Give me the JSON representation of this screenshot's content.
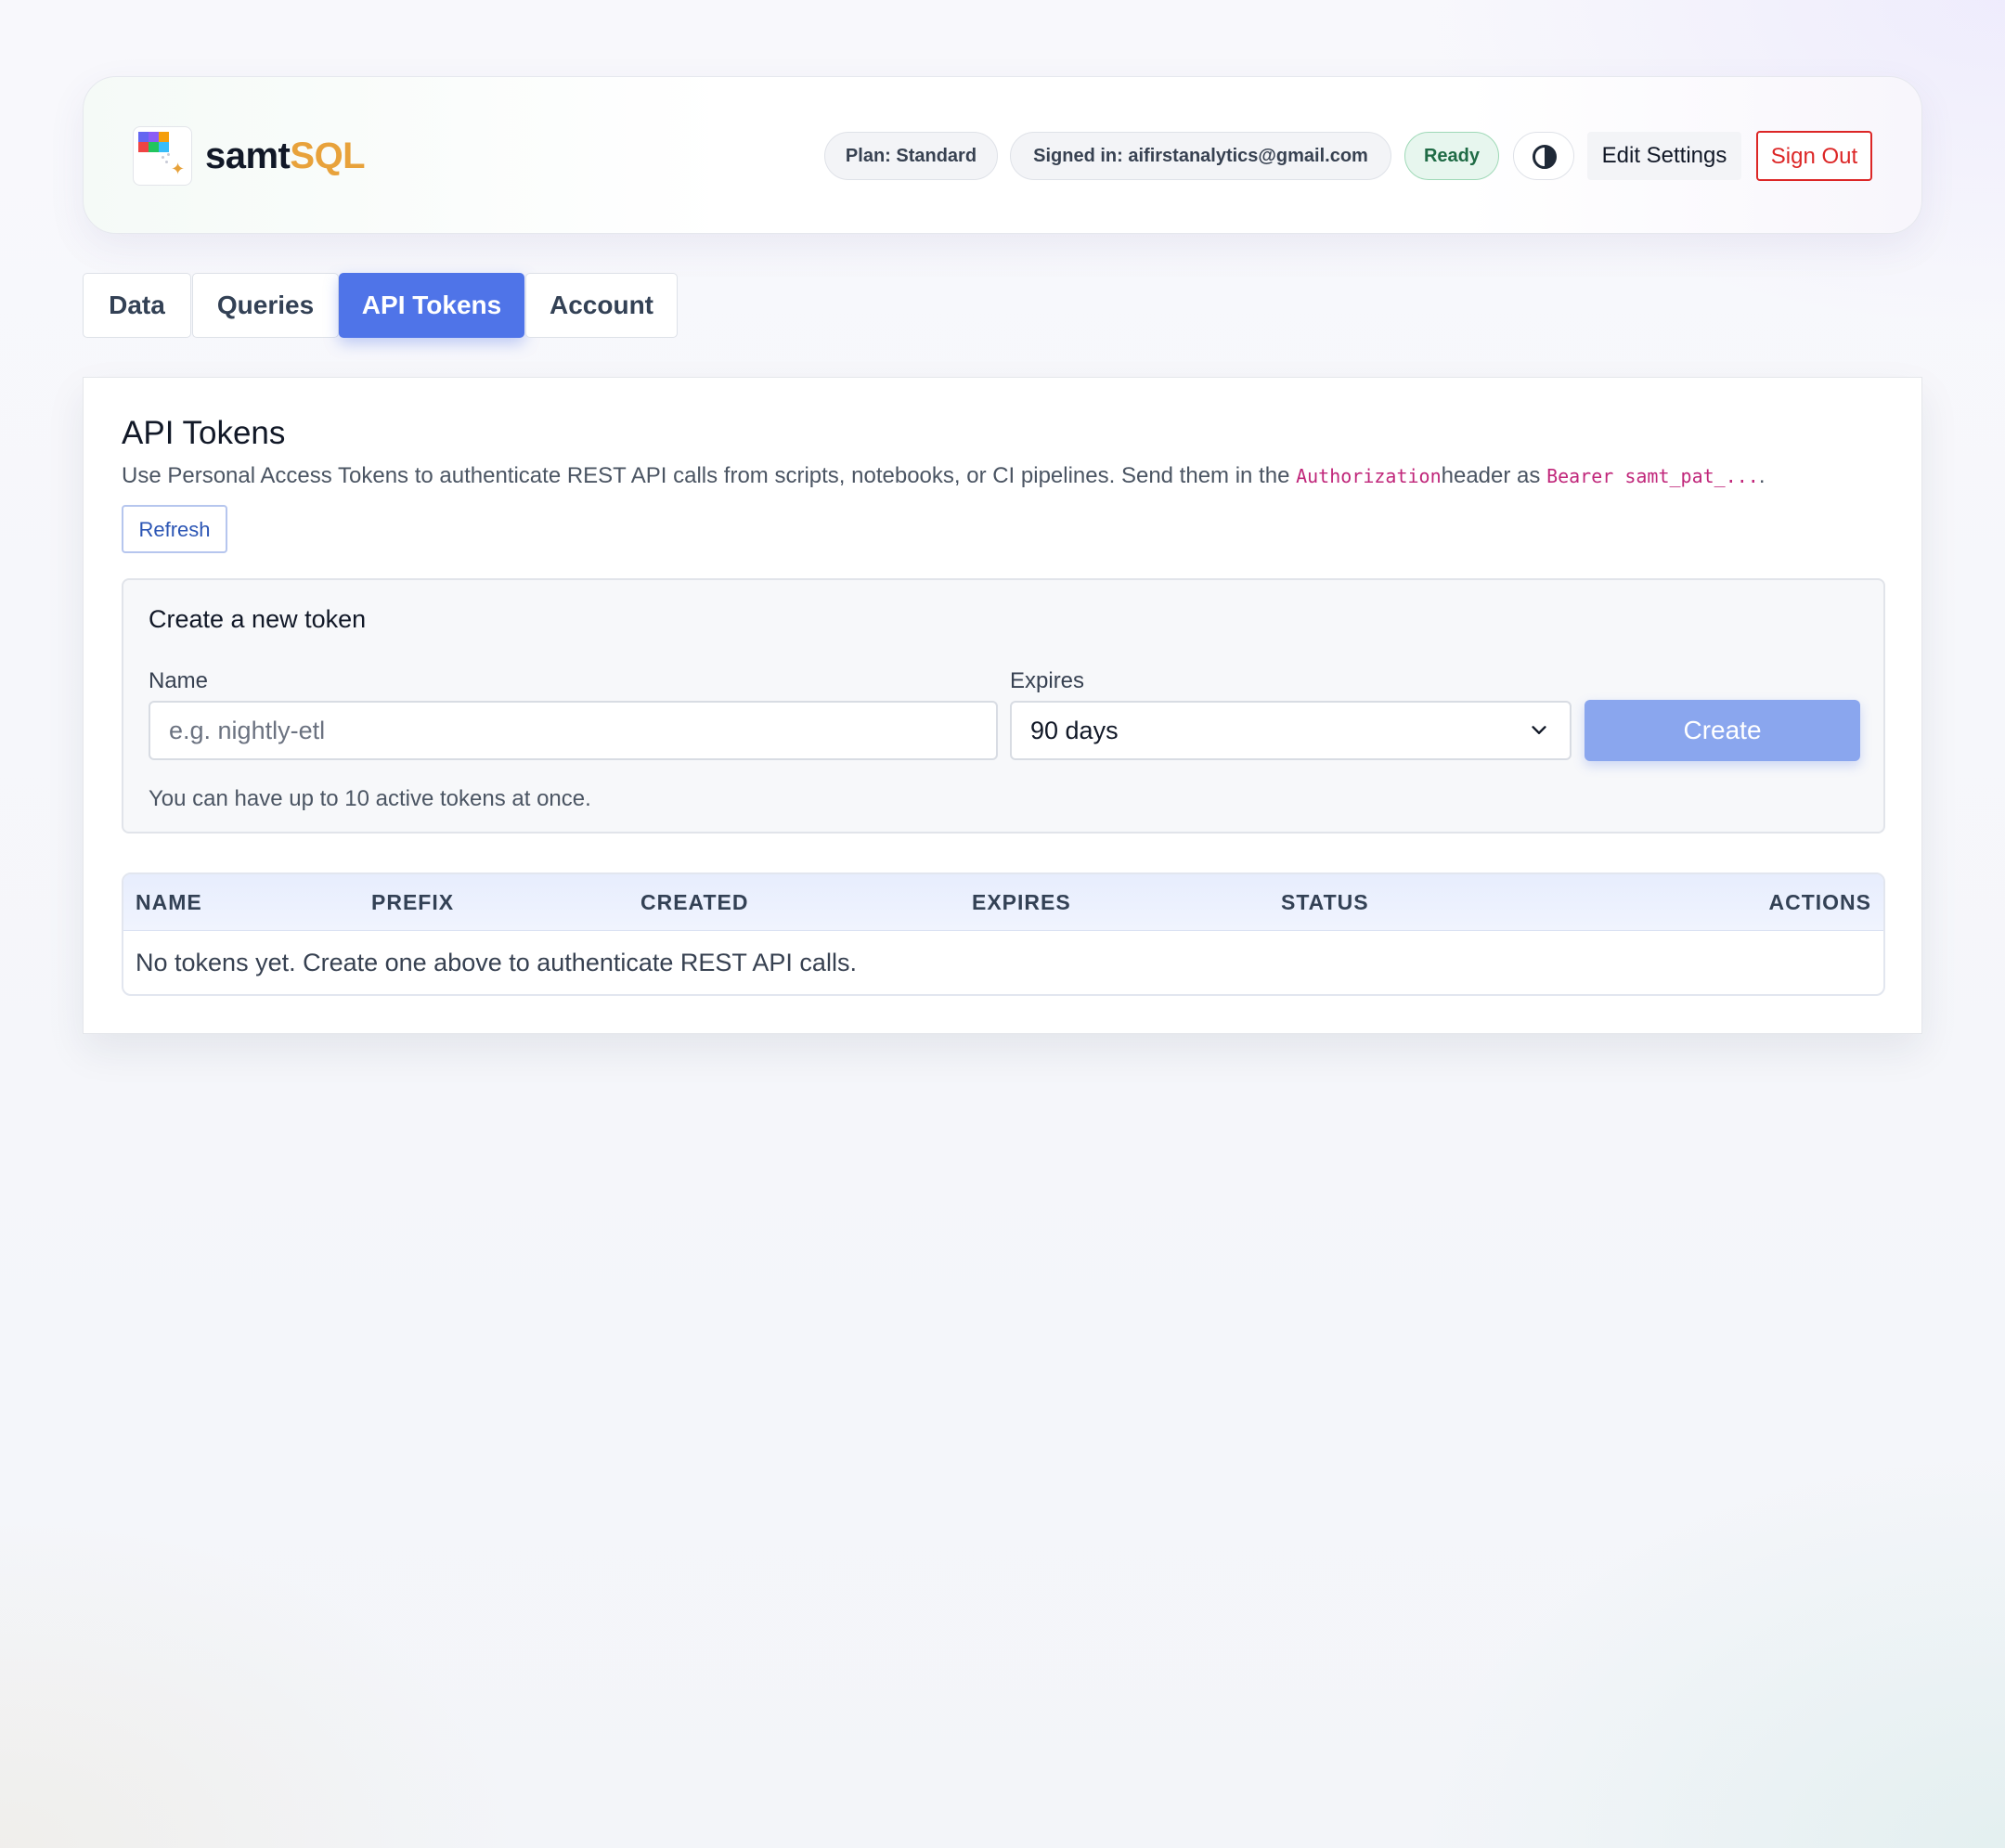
{
  "header": {
    "brand_part1": "samt",
    "brand_part2": "SQL",
    "logo_icon": "grid-sparkle-logo",
    "plan_badge": "Plan: Standard",
    "signed_in_badge": "Signed in: aifirstanalytics@gmail.com",
    "status_badge": "Ready",
    "theme_toggle_icon": "contrast-icon",
    "edit_settings_label": "Edit Settings",
    "sign_out_label": "Sign Out"
  },
  "tabs": [
    {
      "label": "Data",
      "active": false
    },
    {
      "label": "Queries",
      "active": false
    },
    {
      "label": "API Tokens",
      "active": true
    },
    {
      "label": "Account",
      "active": false
    }
  ],
  "main": {
    "title": "API Tokens",
    "description_part1": "Use Personal Access Tokens to authenticate REST API calls from scripts, notebooks, or CI pipelines. Send them in the ",
    "description_code1": "Authorization",
    "description_part2": "header as ",
    "description_code2": "Bearer samt_pat_...",
    "description_part3": ".",
    "refresh_label": "Refresh"
  },
  "create_form": {
    "title": "Create a new token",
    "name_label": "Name",
    "name_placeholder": "e.g. nightly-etl",
    "name_value": "",
    "expires_label": "Expires",
    "expires_value": "90 days",
    "create_label": "Create",
    "hint": "You can have up to 10 active tokens at once."
  },
  "tokens_table": {
    "columns": [
      "NAME",
      "PREFIX",
      "CREATED",
      "EXPIRES",
      "STATUS",
      "ACTIONS"
    ],
    "rows": [],
    "empty_message": "No tokens yet. Create one above to authenticate REST API calls."
  },
  "colors": {
    "accent": "#4f74e8",
    "brand_orange": "#e8a23b",
    "ready_green": "#1f6b45",
    "sign_out_red": "#dc2626",
    "code_pink": "#c0267a"
  }
}
